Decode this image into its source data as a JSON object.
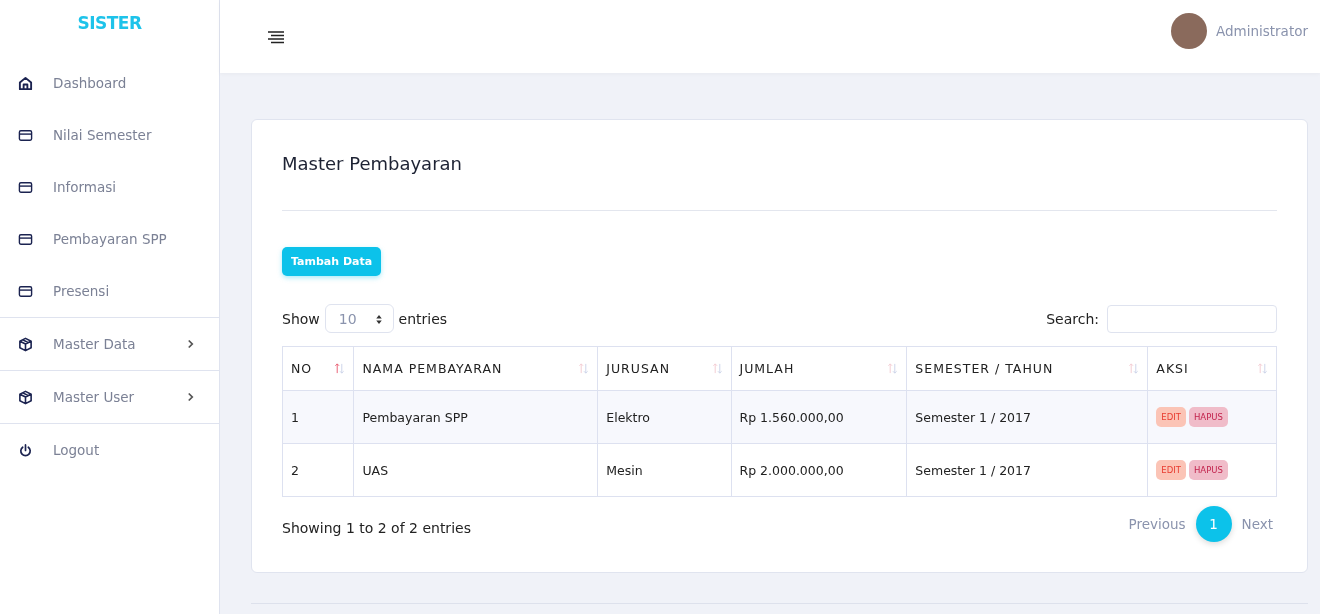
{
  "sidebar": {
    "brand": "SISTER",
    "items": [
      {
        "label": "Dashboard",
        "kind": "home",
        "separated": false,
        "expandable": false
      },
      {
        "label": "Nilai Semester",
        "kind": "card",
        "separated": false,
        "expandable": false
      },
      {
        "label": "Informasi",
        "kind": "card",
        "separated": false,
        "expandable": false
      },
      {
        "label": "Pembayaran SPP",
        "kind": "card",
        "separated": false,
        "expandable": false
      },
      {
        "label": "Presensi",
        "kind": "card",
        "separated": false,
        "expandable": false
      },
      {
        "label": "Master Data",
        "kind": "box",
        "separated": true,
        "expandable": true
      },
      {
        "label": "Master User",
        "kind": "box",
        "separated": true,
        "expandable": true
      },
      {
        "label": "Logout",
        "kind": "power",
        "separated": true,
        "expandable": false
      }
    ]
  },
  "topbar": {
    "user": "Administrator"
  },
  "card": {
    "title": "Master Pembayaran",
    "add_button": "Tambah Data",
    "length": {
      "before": "Show",
      "value": "10",
      "after": "entries"
    },
    "search": {
      "label": "Search:"
    },
    "table": {
      "columns": [
        {
          "label": "NO",
          "sorted": true
        },
        {
          "label": "NAMA PEMBAYARAN",
          "sorted": false
        },
        {
          "label": "JURUSAN",
          "sorted": false
        },
        {
          "label": "JUMLAH",
          "sorted": false
        },
        {
          "label": "SEMESTER / TAHUN",
          "sorted": false
        },
        {
          "label": "AKSI",
          "sorted": false
        }
      ],
      "rows": [
        {
          "cells": [
            "1",
            "Pembayaran SPP",
            "Elektro",
            "Rp 1.560.000,00",
            "Semester 1 / 2017"
          ],
          "actions": [
            "EDIT",
            "HAPUS"
          ]
        },
        {
          "cells": [
            "2",
            "UAS",
            "Mesin",
            "Rp 2.000.000,00",
            "Semester 1 / 2017"
          ],
          "actions": [
            "EDIT",
            "HAPUS"
          ]
        }
      ]
    },
    "info": "Showing 1 to 2 of 2 entries",
    "pagination": {
      "previous": "Previous",
      "pages": [
        {
          "label": "1",
          "selected": true
        }
      ],
      "next": "Next"
    }
  }
}
